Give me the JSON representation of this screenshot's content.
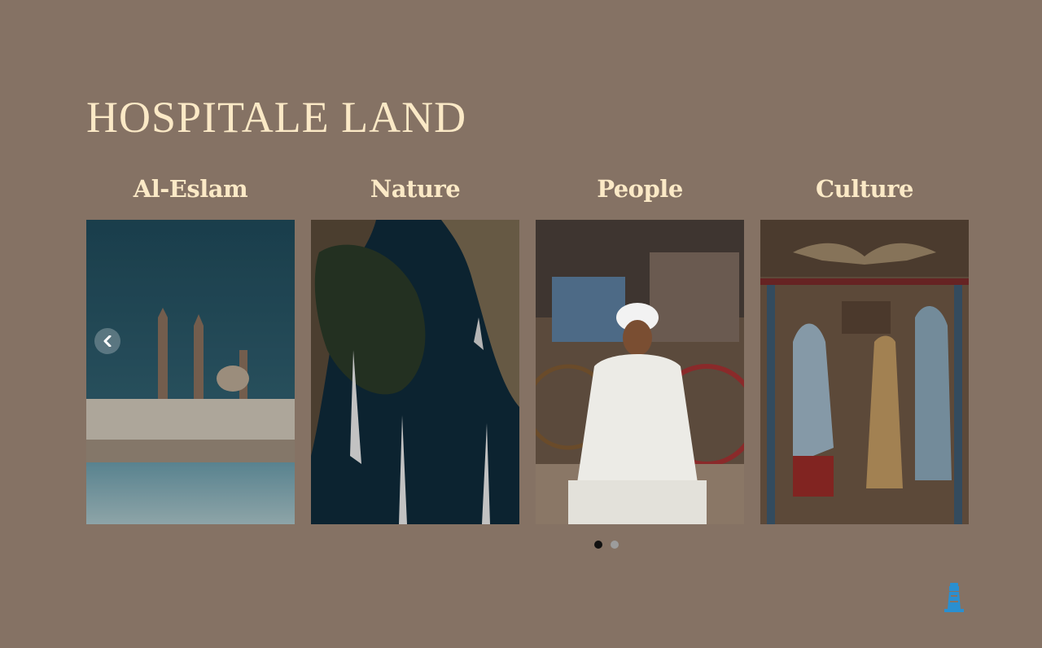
{
  "section": {
    "title": "Hospitale Land"
  },
  "cards": [
    {
      "title": "Al-Eslam",
      "image": "mosque-photo"
    },
    {
      "title": "Nature",
      "image": "nile-river-photo"
    },
    {
      "title": "People",
      "image": "man-with-carriage-photo"
    },
    {
      "title": "Culture",
      "image": "pharaonic-papyrus-photo"
    }
  ],
  "carousel": {
    "prev_icon": "chevron-left-icon",
    "slides": 2,
    "active_slide": 1
  },
  "scroll_top_icon": "lighthouse-icon",
  "colors": {
    "background": "#857264",
    "heading": "#fbe9c6",
    "dot_active": "#111111",
    "dot_inactive": "#9c9c9c",
    "scroll_icon": "#2a8fd0"
  }
}
